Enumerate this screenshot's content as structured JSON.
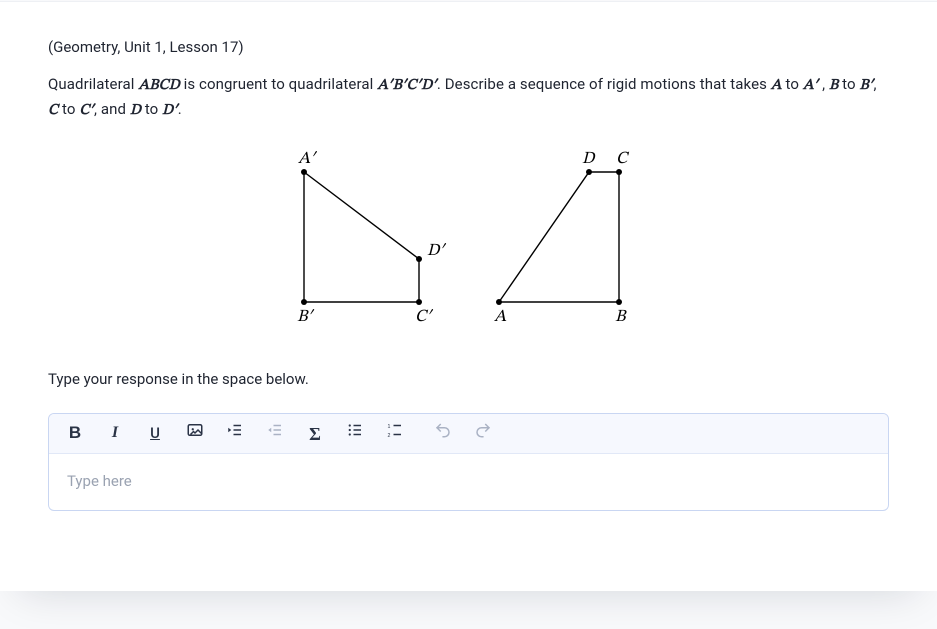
{
  "meta": "(Geometry, Unit 1, Lesson 17)",
  "prompt_parts": {
    "p1": "Quadrilateral ",
    "quad1": "ABCD",
    "p2": " is congruent to quadrilateral ",
    "quad2": "A′B′C′D′",
    "p3": ". Describe a sequence of rigid motions that takes ",
    "a": "A",
    "to1": " to ",
    "ap": "A′",
    "comma1": " , ",
    "b": "B",
    "to2": " to ",
    "bp": "B′",
    "comma2": ", ",
    "c": "C",
    "to3": " to ",
    "cp": "C′",
    "and": ", and ",
    "d": "D",
    "to4": " to ",
    "dp": "D′",
    "period": "."
  },
  "diagram": {
    "labels": {
      "Ap": "A′",
      "Bp": "B′",
      "Cp": "C′",
      "Dp": "D′",
      "A": "A",
      "B": "B",
      "C": "C",
      "D": "D"
    }
  },
  "instruction": "Type your response in the space below.",
  "editor": {
    "placeholder": "Type here"
  },
  "toolbar": {
    "bold": "B",
    "italic": "I",
    "underline": "U",
    "sigma": "Σ"
  }
}
